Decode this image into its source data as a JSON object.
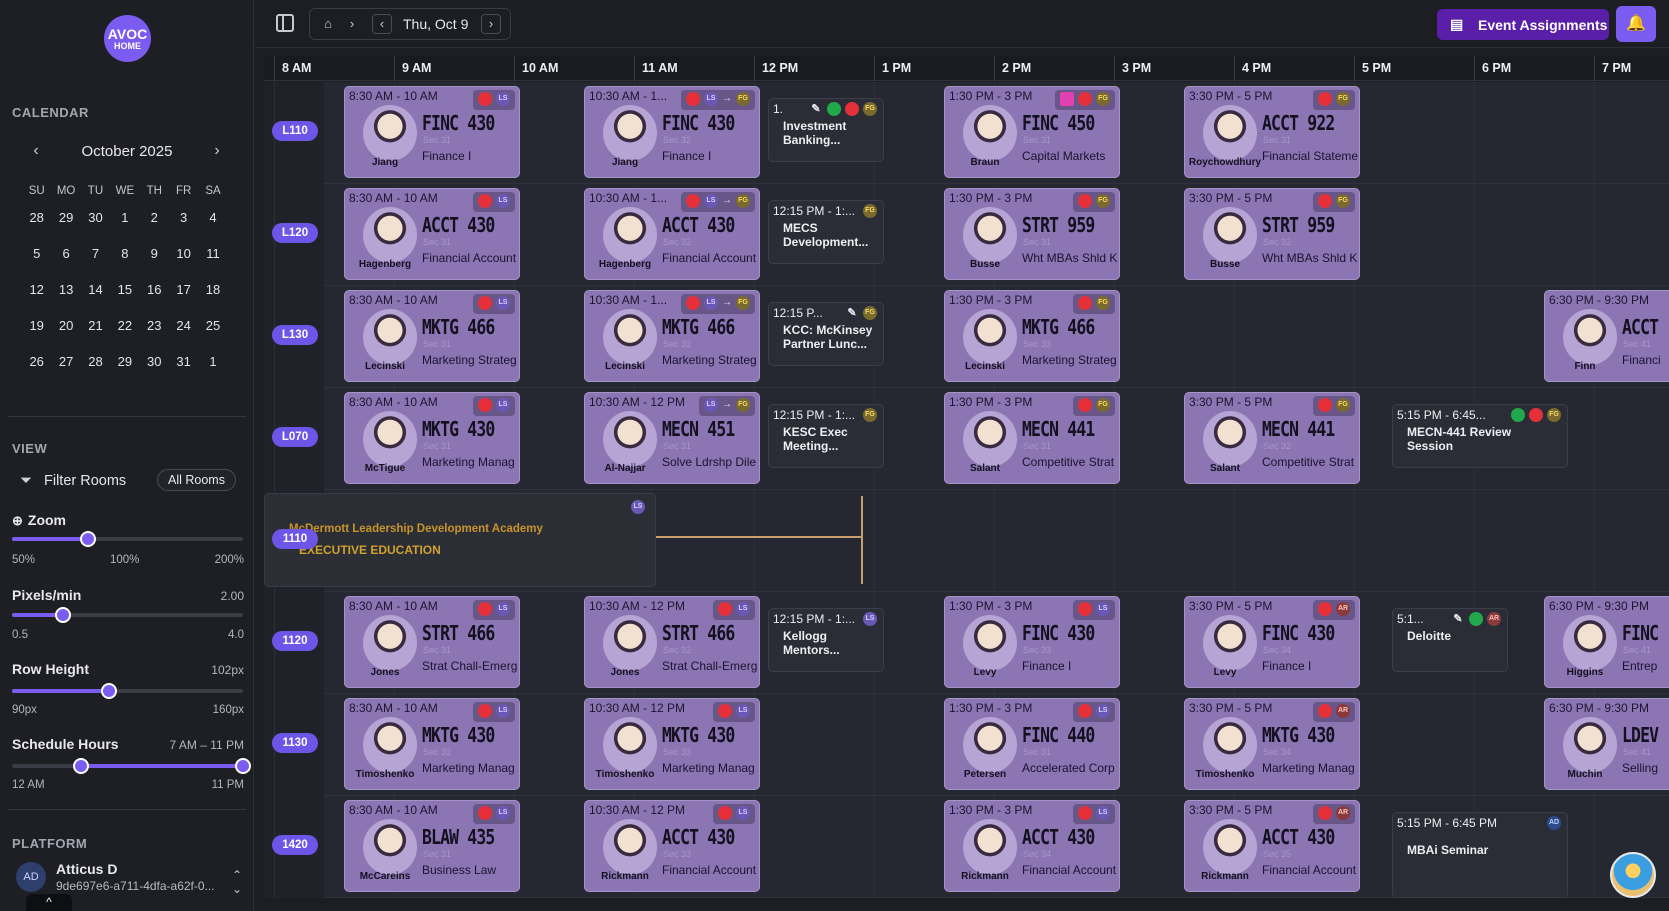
{
  "app": {
    "logo_line1": "AVOC",
    "logo_line2": "HOME"
  },
  "sidebar": {
    "calendar_label": "CALENDAR",
    "month_title": "October 2025",
    "prev_icon": "chevron-left-icon",
    "next_icon": "chevron-right-icon",
    "weekdays": [
      "SU",
      "MO",
      "TU",
      "WE",
      "TH",
      "FR",
      "SA"
    ],
    "weeks": [
      [
        "28",
        "29",
        "30",
        "1",
        "2",
        "3",
        "4"
      ],
      [
        "5",
        "6",
        "7",
        "8",
        "9",
        "10",
        "11"
      ],
      [
        "12",
        "13",
        "14",
        "15",
        "16",
        "17",
        "18"
      ],
      [
        "19",
        "20",
        "21",
        "22",
        "23",
        "24",
        "25"
      ],
      [
        "26",
        "27",
        "28",
        "29",
        "30",
        "31",
        "1"
      ]
    ],
    "view_label": "VIEW",
    "filter_label": "Filter Rooms",
    "filter_icon": "filter-icon",
    "all_rooms": "All Rooms",
    "zoom": {
      "label": "Zoom",
      "icon": "zoom-icon",
      "ticks": [
        "50%",
        "100%",
        "200%"
      ],
      "value_fraction": 0.33
    },
    "pixels_per_min": {
      "label": "Pixels/min",
      "value": "2.00",
      "min": "0.5",
      "max": "4.0",
      "value_fraction": 0.22
    },
    "row_height": {
      "label": "Row Height",
      "value": "102px",
      "min": "90px",
      "max": "160px",
      "value_fraction": 0.42
    },
    "schedule_hours": {
      "label": "Schedule Hours",
      "value": "7 AM – 11 PM",
      "min": "12 AM",
      "max": "11 PM",
      "start_fraction": 0.3,
      "end_fraction": 1.0
    },
    "platform_label": "PLATFORM",
    "user": {
      "initials": "AD",
      "name": "Atticus D",
      "id": "9de697e6-a711-4dfa-a62f-0..."
    }
  },
  "topbar": {
    "sidebar_toggle_icon": "sidebar-toggle-icon",
    "home_icon": "home-icon",
    "date": "Thu, Oct 9",
    "event_assignments": "Event Assignments",
    "clipboard_icon": "clipboard-icon",
    "bell_icon": "bell-icon"
  },
  "timeline": {
    "hours": [
      "8 AM",
      "9 AM",
      "10 AM",
      "11 AM",
      "12 PM",
      "1 PM",
      "2 PM",
      "3 PM",
      "4 PM",
      "5 PM",
      "6 PM",
      "7 PM"
    ]
  },
  "rooms": [
    "L110",
    "L120",
    "L130",
    "L070",
    "1110",
    "1120",
    "1130",
    "1420"
  ],
  "classes": [
    {
      "row": 0,
      "start": 8.5,
      "time": "8:30 AM - 10 AM",
      "code": "FINC 430",
      "sec": "Sec 31",
      "title": "Finance I",
      "inst": "Jiang",
      "badges": [
        "red",
        "ls"
      ]
    },
    {
      "row": 0,
      "start": 10.5,
      "time": "10:30 AM - 1...",
      "code": "FINC 430",
      "sec": "Sec 32",
      "title": "Finance I",
      "inst": "Jiang",
      "badges": [
        "red",
        "ls",
        "arrow",
        "fg"
      ]
    },
    {
      "row": 0,
      "start": 13.5,
      "time": "1:30 PM - 3 PM",
      "code": "FINC 450",
      "sec": "Sec 31",
      "title": "Capital Markets",
      "inst": "Braun",
      "badges": [
        "pink",
        "red",
        "fg"
      ]
    },
    {
      "row": 0,
      "start": 15.5,
      "time": "3:30 PM - 5 PM",
      "code": "ACCT 922",
      "sec": "Sec 31",
      "title": "Financial Stateme",
      "inst": "Roychowdhury",
      "badges": [
        "red",
        "fg"
      ]
    },
    {
      "row": 1,
      "start": 8.5,
      "time": "8:30 AM - 10 AM",
      "code": "ACCT 430",
      "sec": "Sec 31",
      "title": "Financial Account",
      "inst": "Hagenberg",
      "badges": [
        "red",
        "ls"
      ]
    },
    {
      "row": 1,
      "start": 10.5,
      "time": "10:30 AM - 1...",
      "code": "ACCT 430",
      "sec": "Sec 32",
      "title": "Financial Account",
      "inst": "Hagenberg",
      "badges": [
        "red",
        "ls",
        "arrow",
        "fg"
      ]
    },
    {
      "row": 1,
      "start": 13.5,
      "time": "1:30 PM - 3 PM",
      "code": "STRT 959",
      "sec": "Sec 31",
      "title": "Wht MBAs Shld K",
      "inst": "Busse",
      "badges": [
        "red",
        "fg"
      ]
    },
    {
      "row": 1,
      "start": 15.5,
      "time": "3:30 PM - 5 PM",
      "code": "STRT 959",
      "sec": "Sec 32",
      "title": "Wht MBAs Shld K",
      "inst": "Busse",
      "badges": [
        "red",
        "fg"
      ]
    },
    {
      "row": 2,
      "start": 8.5,
      "time": "8:30 AM - 10 AM",
      "code": "MKTG 466",
      "sec": "Sec 31",
      "title": "Marketing Strateg",
      "inst": "Lecinski",
      "badges": [
        "red",
        "ls"
      ]
    },
    {
      "row": 2,
      "start": 10.5,
      "time": "10:30 AM - 1...",
      "code": "MKTG 466",
      "sec": "Sec 32",
      "title": "Marketing Strateg",
      "inst": "Lecinski",
      "badges": [
        "red",
        "ls",
        "arrow",
        "fg"
      ]
    },
    {
      "row": 2,
      "start": 13.5,
      "time": "1:30 PM - 3 PM",
      "code": "MKTG 466",
      "sec": "Sec 33",
      "title": "Marketing Strateg",
      "inst": "Lecinski",
      "badges": [
        "red",
        "fg"
      ]
    },
    {
      "row": 2,
      "start": 18.5,
      "time": "6:30 PM - 9:30 PM",
      "code": "ACCT",
      "sec": "Sec 41",
      "title": "Financi",
      "inst": "Finn",
      "badges": []
    },
    {
      "row": 3,
      "start": 8.5,
      "time": "8:30 AM - 10 AM",
      "code": "MKTG 430",
      "sec": "Sec 31",
      "title": "Marketing Manag",
      "inst": "McTigue",
      "badges": [
        "red",
        "ls"
      ]
    },
    {
      "row": 3,
      "start": 10.5,
      "time": "10:30 AM - 12 PM",
      "code": "MECN 451",
      "sec": "Sec 31",
      "title": "Solve Ldrshp Dile",
      "inst": "Al-Najjar",
      "badges": [
        "ls",
        "arrow",
        "fg"
      ]
    },
    {
      "row": 3,
      "start": 13.5,
      "time": "1:30 PM - 3 PM",
      "code": "MECN 441",
      "sec": "Sec 31",
      "title": "Competitive Strat",
      "inst": "Salant",
      "badges": [
        "red",
        "fg"
      ]
    },
    {
      "row": 3,
      "start": 15.5,
      "time": "3:30 PM - 5 PM",
      "code": "MECN 441",
      "sec": "Sec 32",
      "title": "Competitive Strat",
      "inst": "Salant",
      "badges": [
        "red",
        "fg"
      ]
    },
    {
      "row": 5,
      "start": 8.5,
      "time": "8:30 AM - 10 AM",
      "code": "STRT 466",
      "sec": "Sec 31",
      "title": "Strat Chall-Emerg",
      "inst": "Jones",
      "badges": [
        "red",
        "ls"
      ]
    },
    {
      "row": 5,
      "start": 10.5,
      "time": "10:30 AM - 12 PM",
      "code": "STRT 466",
      "sec": "Sec 32",
      "title": "Strat Chall-Emerg",
      "inst": "Jones",
      "badges": [
        "red",
        "ls"
      ]
    },
    {
      "row": 5,
      "start": 13.5,
      "time": "1:30 PM - 3 PM",
      "code": "FINC 430",
      "sec": "Sec 33",
      "title": "Finance I",
      "inst": "Levy",
      "badges": [
        "red",
        "ls"
      ]
    },
    {
      "row": 5,
      "start": 15.5,
      "time": "3:30 PM - 5 PM",
      "code": "FINC 430",
      "sec": "Sec 34",
      "title": "Finance I",
      "inst": "Levy",
      "badges": [
        "red",
        "ar"
      ]
    },
    {
      "row": 5,
      "start": 18.5,
      "time": "6:30 PM - 9:30 PM",
      "code": "FINC",
      "sec": "Sec 41",
      "title": "Entrep",
      "inst": "Higgins",
      "badges": []
    },
    {
      "row": 6,
      "start": 8.5,
      "time": "8:30 AM - 10 AM",
      "code": "MKTG 430",
      "sec": "Sec 32",
      "title": "Marketing Manag",
      "inst": "Timoshenko",
      "badges": [
        "red",
        "ls"
      ]
    },
    {
      "row": 6,
      "start": 10.5,
      "time": "10:30 AM - 12 PM",
      "code": "MKTG 430",
      "sec": "Sec 33",
      "title": "Marketing Manag",
      "inst": "Timoshenko",
      "badges": [
        "red",
        "ls"
      ]
    },
    {
      "row": 6,
      "start": 13.5,
      "time": "1:30 PM - 3 PM",
      "code": "FINC 440",
      "sec": "Sec 31",
      "title": "Accelerated Corp",
      "inst": "Petersen",
      "badges": [
        "red",
        "ls"
      ]
    },
    {
      "row": 6,
      "start": 15.5,
      "time": "3:30 PM - 5 PM",
      "code": "MKTG 430",
      "sec": "Sec 34",
      "title": "Marketing Manag",
      "inst": "Timoshenko",
      "badges": [
        "red",
        "ar"
      ]
    },
    {
      "row": 6,
      "start": 18.5,
      "time": "6:30 PM - 9:30 PM",
      "code": "LDEV",
      "sec": "Sec 41",
      "title": "Selling",
      "inst": "Muchin",
      "badges": []
    },
    {
      "row": 7,
      "start": 8.5,
      "time": "8:30 AM - 10 AM",
      "code": "BLAW 435",
      "sec": "Sec 31",
      "title": "Business Law",
      "inst": "McCareins",
      "badges": [
        "red",
        "ls"
      ]
    },
    {
      "row": 7,
      "start": 10.5,
      "time": "10:30 AM - 12 PM",
      "code": "ACCT 430",
      "sec": "Sec 33",
      "title": "Financial Account",
      "inst": "Rickmann",
      "badges": [
        "red",
        "ls"
      ]
    },
    {
      "row": 7,
      "start": 13.5,
      "time": "1:30 PM - 3 PM",
      "code": "ACCT 430",
      "sec": "Sec 34",
      "title": "Financial Account",
      "inst": "Rickmann",
      "badges": [
        "red",
        "ls"
      ]
    },
    {
      "row": 7,
      "start": 15.5,
      "time": "3:30 PM - 5 PM",
      "code": "ACCT 430",
      "sec": "Sec 35",
      "title": "Financial Account",
      "inst": "Rickmann",
      "badges": [
        "red",
        "ar"
      ]
    }
  ],
  "events": [
    {
      "row": 0,
      "start": 12.05,
      "time": "1.",
      "name": "Investment Banking...",
      "badges": [
        "tool",
        "grn",
        "red",
        "fg"
      ]
    },
    {
      "row": 1,
      "start": 12.05,
      "time": "12:15 PM - 1:...",
      "name": "MECS Development...",
      "badges": [
        "fg"
      ]
    },
    {
      "row": 2,
      "start": 12.05,
      "time": "12:15 P...",
      "name": "KCC: McKinsey Partner Lunc...",
      "badges": [
        "tool",
        "fg"
      ]
    },
    {
      "row": 3,
      "start": 12.05,
      "time": "12:15 PM - 1:...",
      "name": "KESC Exec Meeting...",
      "badges": [
        "fg"
      ]
    },
    {
      "row": 3,
      "start": 17.25,
      "time": "5:15 PM - 6:45...",
      "name": "MECN-441 Review Session",
      "badges": [
        "grn",
        "red",
        "fg"
      ],
      "wide": true
    },
    {
      "row": 5,
      "start": 12.05,
      "time": "12:15 PM - 1:...",
      "name": "Kellogg Mentors...",
      "badges": [
        "ls"
      ]
    },
    {
      "row": 5,
      "start": 17.25,
      "time": "5:1...",
      "name": "Deloitte",
      "badges": [
        "tool",
        "grn",
        "ar"
      ]
    },
    {
      "row": 7,
      "start": 17.25,
      "time": "5:15 PM - 6:45 PM",
      "name": "MBAi Seminar",
      "badges": [
        "ad"
      ],
      "wide": true,
      "tall": true
    }
  ],
  "exec_block": {
    "title": "McDermott Leadership Development Academy",
    "subtitle": "EXECUTIVE EDUCATION",
    "badge": "LS"
  },
  "badge_text": {
    "ls": "LS",
    "fg": "FG",
    "ar": "AR",
    "ad": "AD"
  },
  "colors": {
    "accent": "#7a5cf0",
    "event_assign_bg": "#5a1fa8",
    "class_card": "#8b76b3",
    "room_pill": "#6d55e8",
    "exec_text": "#c8942a"
  },
  "corner_avatar_icon": "beach-avatar-icon"
}
